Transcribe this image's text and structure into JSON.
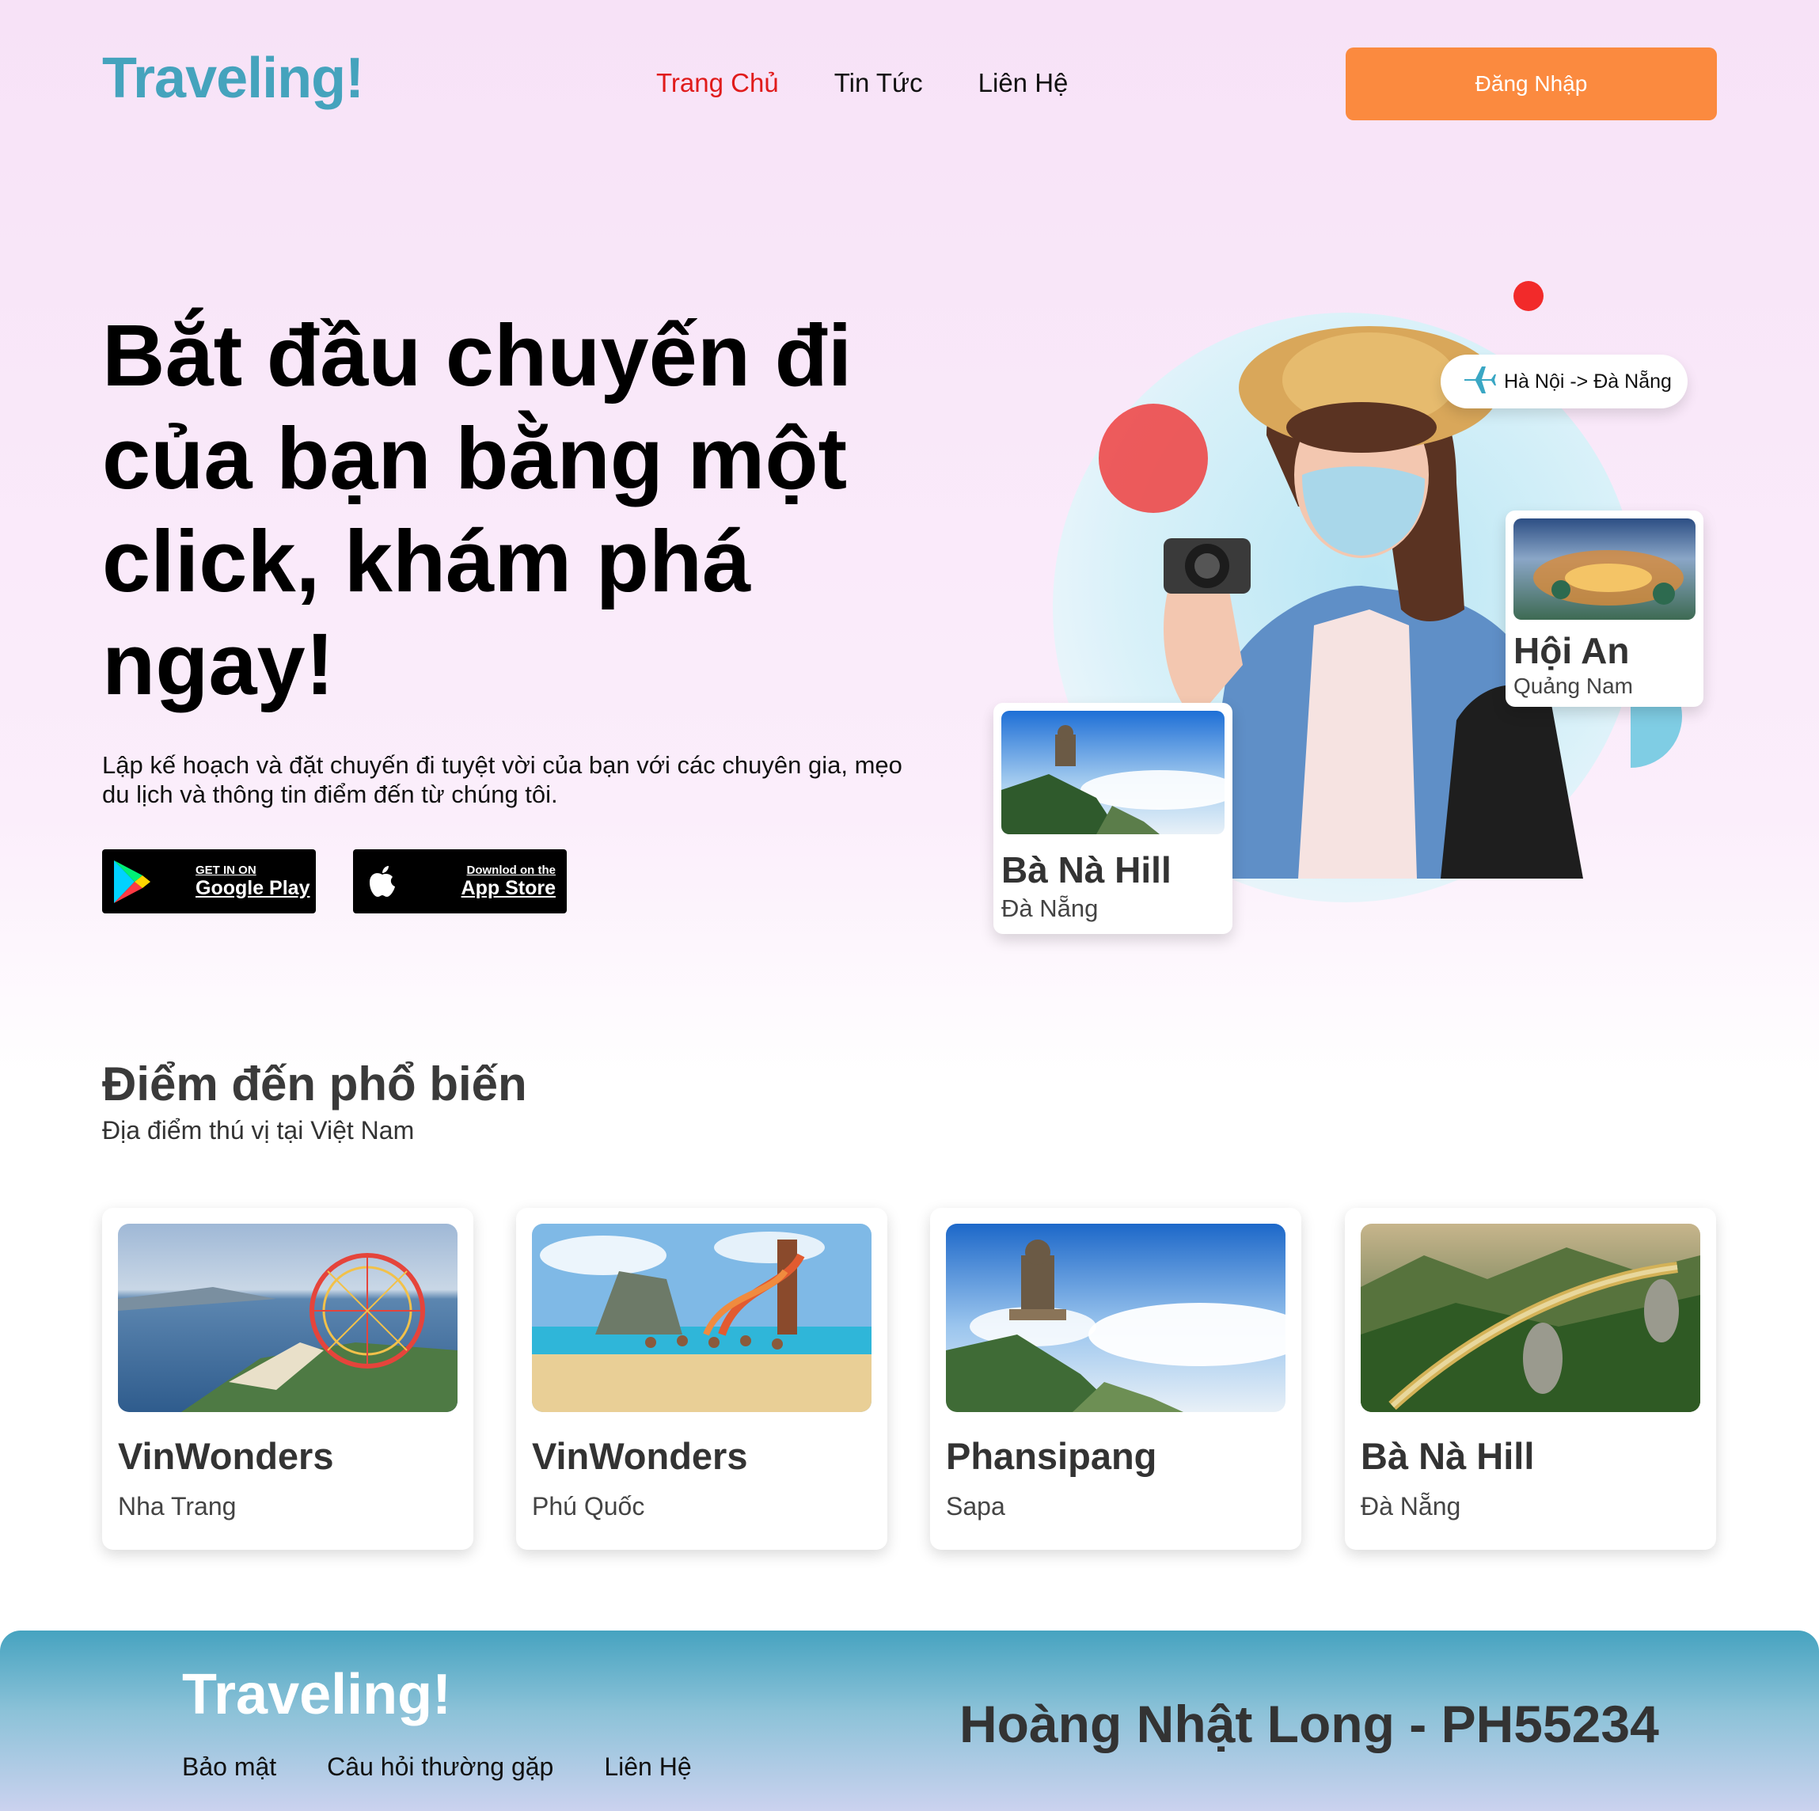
{
  "header": {
    "logo": "Traveling!",
    "nav": [
      {
        "label": "Trang Chủ"
      },
      {
        "label": "Tin Tức"
      },
      {
        "label": "Liên Hệ"
      }
    ],
    "login_label": "Đăng Nhập"
  },
  "hero": {
    "title": "Bắt đầu chuyến đi của bạn bằng một click, khám phá ngay!",
    "description": "Lập kế hoạch và đặt chuyến đi tuyệt vời của bạn với các chuyên gia, mẹo du lịch và thông tin điểm đến từ chúng tôi.",
    "google_play": {
      "small": "GET IN ON",
      "big": "Google Play"
    },
    "app_store": {
      "small": "Downlod on the",
      "big": "App Store"
    },
    "flight": "Hà Nội -> Đà Nẵng",
    "card_hoian": {
      "title": "Hội An",
      "subtitle": "Quảng Nam"
    },
    "card_bana": {
      "title": "Bà Nà Hill",
      "subtitle": "Đà Nẵng"
    }
  },
  "popular": {
    "title": "Điểm đến phổ biến",
    "subtitle": "Địa điểm thú vị tại Việt Nam",
    "cards": [
      {
        "title": "VinWonders",
        "subtitle": "Nha Trang"
      },
      {
        "title": "VinWonders",
        "subtitle": "Phú Quốc"
      },
      {
        "title": "Phansipang",
        "subtitle": "Sapa"
      },
      {
        "title": "Bà Nà Hill",
        "subtitle": "Đà Nẵng"
      }
    ]
  },
  "footer": {
    "logo": "Traveling!",
    "links": [
      {
        "label": "Bảo mật"
      },
      {
        "label": "Câu hỏi thường gặp"
      },
      {
        "label": "Liên Hệ"
      }
    ],
    "author": "Hoàng Nhật Long - PH55234"
  },
  "colors": {
    "brand": "#45a3bd",
    "accent": "#fb8a3f",
    "active_nav": "#e01b1b"
  }
}
